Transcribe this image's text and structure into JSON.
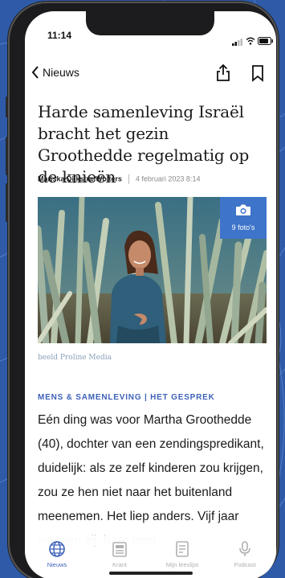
{
  "status_bar": {
    "time": "11:14"
  },
  "nav": {
    "back_label": "Nieuws",
    "share_icon": "share-icon",
    "bookmark_icon": "bookmark-icon"
  },
  "article": {
    "title": "Harde samenleving Israël bracht het gezin Groothedde regelmatig op de knieën",
    "author": "Mariska Dijkstra-Wolters",
    "date": "4 februari 2023 8:14",
    "photo": {
      "count_label": "9 foto's",
      "badge_icon": "camera-icon"
    },
    "caption": "beeld Proline Media",
    "category": "MENS & SAMENLEVING | HET GESPREK",
    "body": "Eén ding was voor Martha Groothedde (40), dochter van een zendingspredikant, duidelijk: als ze zelf kinderen zou krijgen, zou ze hen niet naar het buitenland meenemen. Het liep anders. Vijf jaar woonen zij, haar man"
  },
  "tab_bar": {
    "tabs": [
      {
        "label": "Nieuws",
        "icon": "globe-icon",
        "active": true
      },
      {
        "label": "Krant",
        "icon": "newspaper-icon",
        "active": false
      },
      {
        "label": "Mijn leeslijst",
        "icon": "reading-list-icon",
        "active": false
      },
      {
        "label": "Podcast",
        "icon": "microphone-icon",
        "active": false
      }
    ]
  },
  "colors": {
    "background": "#2e5aa8",
    "accent": "#3e62b8",
    "badge": "#3e74c9"
  }
}
